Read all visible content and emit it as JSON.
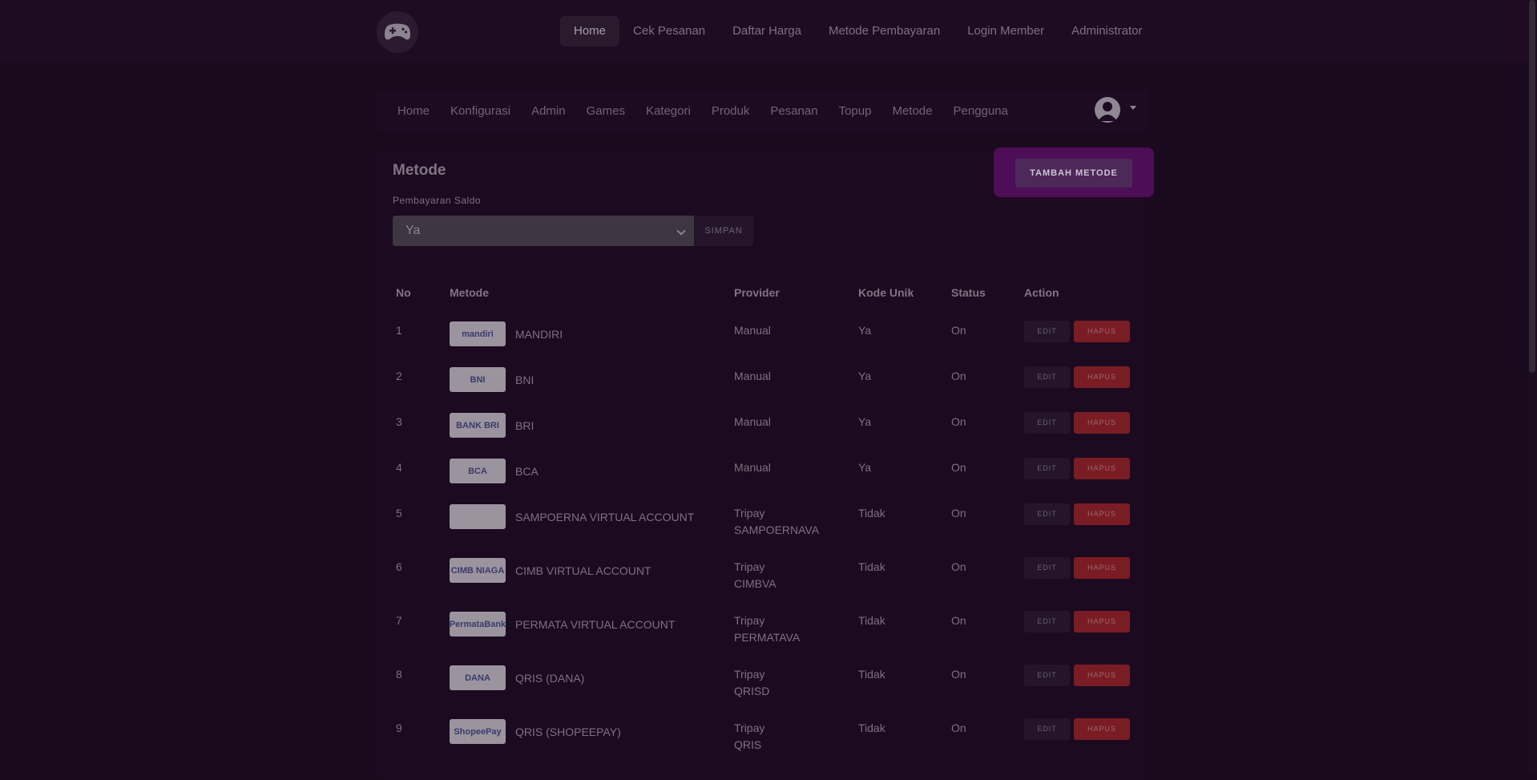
{
  "topnav": [
    "Home",
    "Cek Pesanan",
    "Daftar Harga",
    "Metode Pembayaran",
    "Login Member",
    "Administrator"
  ],
  "subnav": [
    "Home",
    "Konfigurasi",
    "Admin",
    "Games",
    "Kategori",
    "Produk",
    "Pesanan",
    "Topup",
    "Metode",
    "Pengguna"
  ],
  "card": {
    "title": "Metode",
    "saldo_label": "Pembayaran Saldo",
    "saldo_value": "Ya",
    "simpan_label": "SIMPAN",
    "tambah_label": "TAMBAH METODE"
  },
  "table": {
    "headers": [
      "No",
      "Metode",
      "Provider",
      "Kode Unik",
      "Status",
      "Action"
    ],
    "edit_label": "EDIT",
    "hapus_label": "HAPUS",
    "rows": [
      {
        "no": "1",
        "logo": "mandiri",
        "metode": "MANDIRI",
        "provider": "Manual",
        "provider2": "",
        "kode": "Ya",
        "status": "On"
      },
      {
        "no": "2",
        "logo": "BNI",
        "metode": "BNI",
        "provider": "Manual",
        "provider2": "",
        "kode": "Ya",
        "status": "On"
      },
      {
        "no": "3",
        "logo": "BANK BRI",
        "metode": "BRI",
        "provider": "Manual",
        "provider2": "",
        "kode": "Ya",
        "status": "On"
      },
      {
        "no": "4",
        "logo": "BCA",
        "metode": "BCA",
        "provider": "Manual",
        "provider2": "",
        "kode": "Ya",
        "status": "On"
      },
      {
        "no": "5",
        "logo": "",
        "metode": "SAMPOERNA VIRTUAL ACCOUNT",
        "provider": "Tripay",
        "provider2": "SAMPOERNAVA",
        "kode": "Tidak",
        "status": "On"
      },
      {
        "no": "6",
        "logo": "CIMB NIAGA",
        "metode": "CIMB VIRTUAL ACCOUNT",
        "provider": "Tripay",
        "provider2": "CIMBVA",
        "kode": "Tidak",
        "status": "On"
      },
      {
        "no": "7",
        "logo": "PermataBank",
        "metode": "PERMATA VIRTUAL ACCOUNT",
        "provider": "Tripay",
        "provider2": "PERMATAVA",
        "kode": "Tidak",
        "status": "On"
      },
      {
        "no": "8",
        "logo": "DANA",
        "metode": "QRIS (DANA)",
        "provider": "Tripay",
        "provider2": "QRISD",
        "kode": "Tidak",
        "status": "On"
      },
      {
        "no": "9",
        "logo": "ShopeePay",
        "metode": "QRIS (SHOPEEPAY)",
        "provider": "Tripay",
        "provider2": "QRIS",
        "kode": "Tidak",
        "status": "On"
      }
    ]
  }
}
